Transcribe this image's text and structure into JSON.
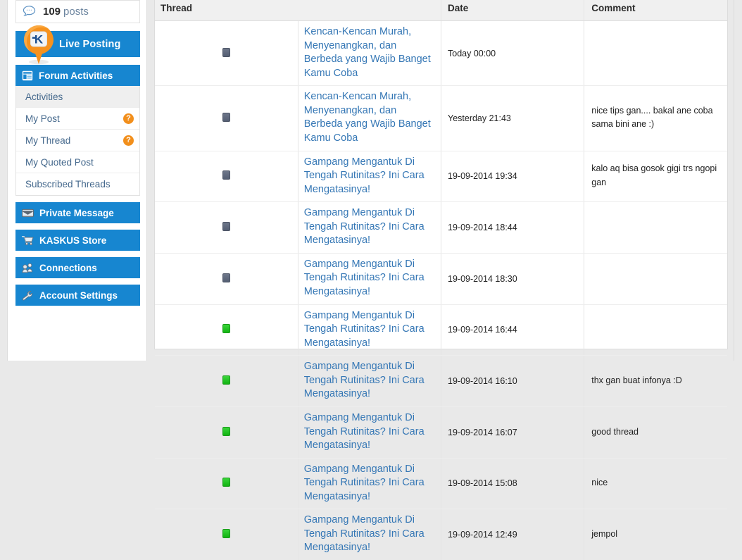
{
  "sidebar": {
    "stats": {
      "count": "109",
      "label": "posts",
      "icon": "speech-bubble-icon"
    },
    "live_posting": {
      "label": "Live Posting",
      "icon": "kaskus-pin-icon"
    },
    "forum_activities": {
      "title": "Forum Activities",
      "icon": "forum-activities-icon",
      "items": [
        {
          "label": "Activities",
          "badge": "",
          "active": true
        },
        {
          "label": "My Post",
          "badge": "?",
          "active": false
        },
        {
          "label": "My Thread",
          "badge": "?",
          "active": false
        },
        {
          "label": "My Quoted Post",
          "badge": "",
          "active": false
        },
        {
          "label": "Subscribed Threads",
          "badge": "",
          "active": false
        }
      ]
    },
    "buttons": [
      {
        "label": "Private Message",
        "icon": "envelope-icon"
      },
      {
        "label": "KASKUS Store",
        "icon": "shopping-cart-icon"
      },
      {
        "label": "Connections",
        "icon": "connections-icon"
      },
      {
        "label": "Account Settings",
        "icon": "wrench-icon"
      }
    ]
  },
  "table": {
    "columns": [
      "Thread",
      "Date",
      "Comment"
    ],
    "rows": [
      {
        "status": "gray",
        "thread": "Kencan-Kencan Murah, Menyenangkan, dan Berbeda yang Wajib Banget Kamu Coba",
        "date": "Today 00:00",
        "comment": ""
      },
      {
        "status": "gray",
        "thread": "Kencan-Kencan Murah, Menyenangkan, dan Berbeda yang Wajib Banget Kamu Coba",
        "date": "Yesterday 21:43",
        "comment": "nice tips gan.... bakal ane coba sama bini ane :)"
      },
      {
        "status": "gray",
        "thread": "Gampang Mengantuk Di Tengah Rutinitas? Ini Cara Mengatasinya!",
        "date": "19-09-2014 19:34",
        "comment": "kalo aq bisa gosok gigi trs ngopi gan"
      },
      {
        "status": "gray",
        "thread": "Gampang Mengantuk Di Tengah Rutinitas? Ini Cara Mengatasinya!",
        "date": "19-09-2014 18:44",
        "comment": ""
      },
      {
        "status": "gray",
        "thread": "Gampang Mengantuk Di Tengah Rutinitas? Ini Cara Mengatasinya!",
        "date": "19-09-2014 18:30",
        "comment": ""
      },
      {
        "status": "green",
        "thread": "Gampang Mengantuk Di Tengah Rutinitas? Ini Cara Mengatasinya!",
        "date": "19-09-2014 16:44",
        "comment": ""
      },
      {
        "status": "green",
        "thread": "Gampang Mengantuk Di Tengah Rutinitas? Ini Cara Mengatasinya!",
        "date": "19-09-2014 16:10",
        "comment": "thx gan buat infonya :D"
      },
      {
        "status": "green",
        "thread": "Gampang Mengantuk Di Tengah Rutinitas? Ini Cara Mengatasinya!",
        "date": "19-09-2014 16:07",
        "comment": "good thread"
      },
      {
        "status": "green",
        "thread": "Gampang Mengantuk Di Tengah Rutinitas? Ini Cara Mengatasinya!",
        "date": "19-09-2014 15:08",
        "comment": "nice"
      },
      {
        "status": "green",
        "thread": "Gampang Mengantuk Di Tengah Rutinitas? Ini Cara Mengatasinya!",
        "date": "19-09-2014 12:49",
        "comment": "jempol"
      }
    ]
  },
  "colors": {
    "brand_blue": "#1786d0",
    "accent_orange": "#f28f1c",
    "link_blue": "#3577b5",
    "status_green": "#17b317",
    "status_gray": "#5a6478"
  }
}
